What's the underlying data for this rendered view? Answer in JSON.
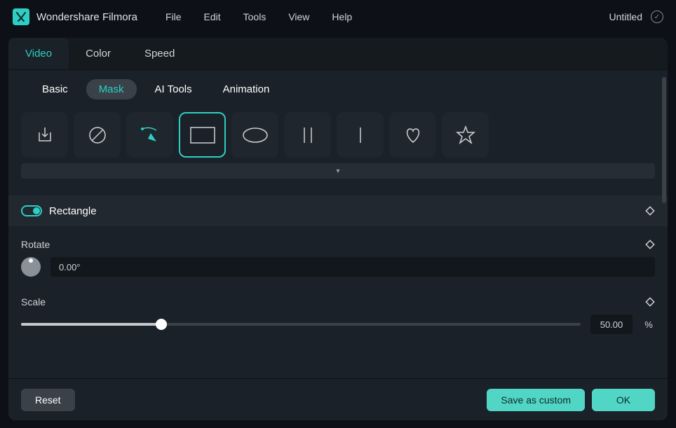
{
  "app": {
    "title": "Wondershare Filmora",
    "document": "Untitled"
  },
  "menu": {
    "file": "File",
    "edit": "Edit",
    "tools": "Tools",
    "view": "View",
    "help": "Help"
  },
  "topTabs": {
    "video": "Video",
    "color": "Color",
    "speed": "Speed"
  },
  "subTabs": {
    "basic": "Basic",
    "mask": "Mask",
    "aitools": "AI Tools",
    "animation": "Animation"
  },
  "shapes": {
    "import": "import-shape",
    "none": "none-shape",
    "pen": "pen-shape",
    "rectangle": "rectangle-shape",
    "ellipse": "ellipse-shape",
    "vlines": "vlines-shape",
    "vline": "vline-shape",
    "heart": "heart-shape",
    "star": "star-shape"
  },
  "expand": "▾",
  "section": {
    "title": "Rectangle"
  },
  "rotate": {
    "label": "Rotate",
    "value": "0.00°"
  },
  "scale": {
    "label": "Scale",
    "value": "50.00",
    "unit": "%",
    "percent": 25
  },
  "footer": {
    "reset": "Reset",
    "saveCustom": "Save as custom",
    "ok": "OK"
  }
}
